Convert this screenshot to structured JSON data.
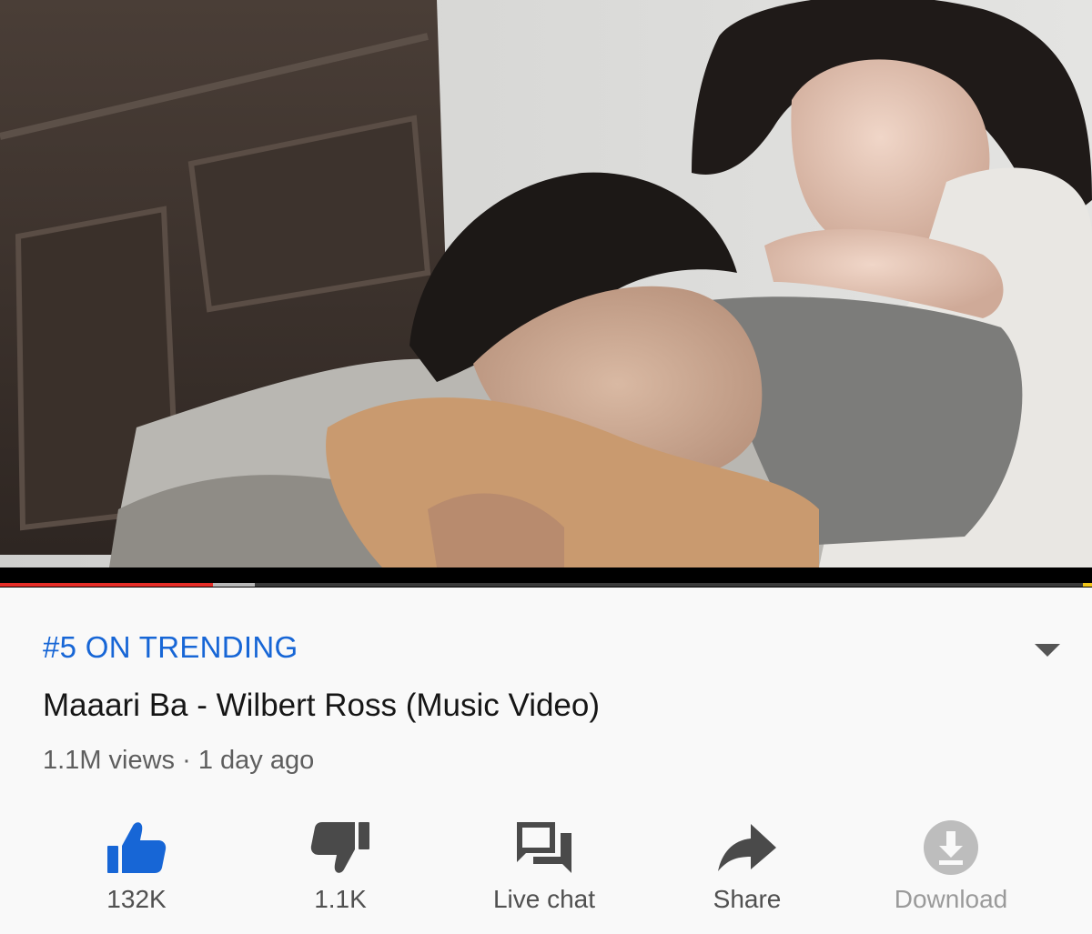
{
  "video": {
    "progress": {
      "played_fraction": 0.195,
      "buffered_fraction": 0.233
    }
  },
  "info": {
    "trending_label": "#5 ON TRENDING",
    "title": "Maaari Ba - Wilbert Ross (Music Video)",
    "meta": "1.1M views · 1 day ago",
    "expand_icon": "chevron-down-icon"
  },
  "actions": {
    "like": {
      "label": "132K",
      "icon": "thumbs-up-icon"
    },
    "dislike": {
      "label": "1.1K",
      "icon": "thumbs-down-icon"
    },
    "live_chat": {
      "label": "Live chat",
      "icon": "chat-bubbles-icon"
    },
    "share": {
      "label": "Share",
      "icon": "share-arrow-icon"
    },
    "download": {
      "label": "Download",
      "icon": "download-icon"
    }
  },
  "colors": {
    "accent_blue": "#1766d6",
    "progress_red": "#e52d27",
    "progress_end_yellow": "#f0c419",
    "icon_dark": "#4a4a4a",
    "icon_disabled": "#bdbdbd"
  }
}
